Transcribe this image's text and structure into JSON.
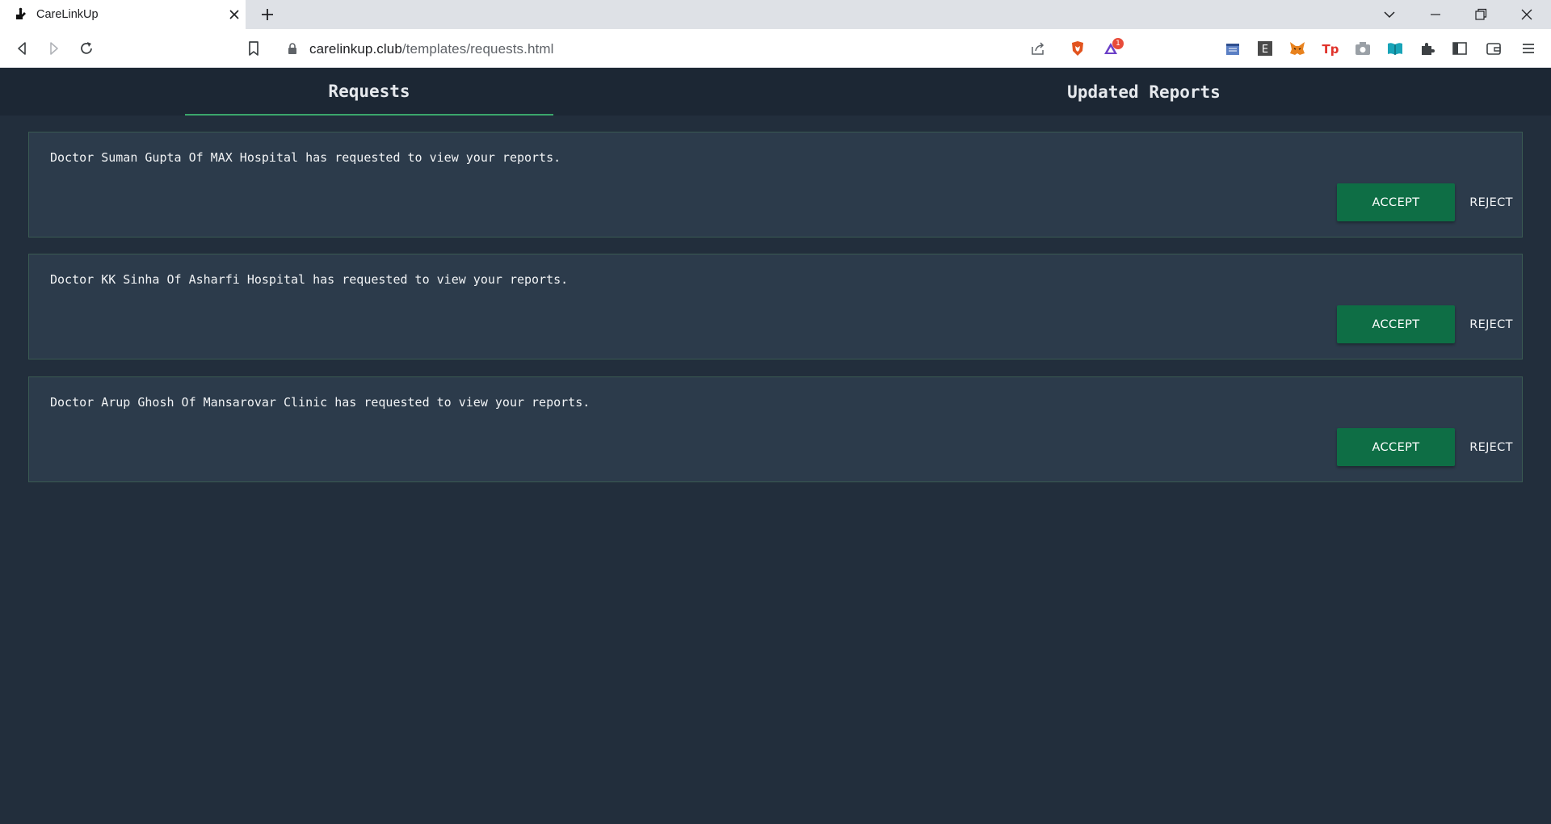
{
  "browser": {
    "tab_title": "CareLinkUp",
    "url_host": "carelinkup.club",
    "url_path": "/templates/requests.html",
    "notification_badge": "1"
  },
  "page": {
    "tabs": [
      {
        "label": "Requests",
        "active": true
      },
      {
        "label": "Updated Reports",
        "active": false
      }
    ],
    "requests": [
      {
        "message": "Doctor Suman Gupta Of MAX Hospital has requested to view your reports.",
        "accept_label": "ACCEPT",
        "reject_label": "REJECT"
      },
      {
        "message": "Doctor KK Sinha Of Asharfi Hospital has requested to view your reports.",
        "accept_label": "ACCEPT",
        "reject_label": "REJECT"
      },
      {
        "message": "Doctor Arup Ghosh Of Mansarovar Clinic has requested to view your reports.",
        "accept_label": "ACCEPT",
        "reject_label": "REJECT"
      }
    ]
  },
  "colors": {
    "page_background": "#222e3c",
    "tab_row_background": "#1c2734",
    "card_background": "#2c3b4b",
    "accept_button": "#0e6e45",
    "active_tab_underline": "#3aa66b"
  },
  "icons": [
    "carelinkup-favicon",
    "close-icon",
    "plus-icon",
    "chevron-down-icon",
    "minimize-icon",
    "restore-icon",
    "close-window-icon",
    "back-icon",
    "forward-icon",
    "reload-icon",
    "bookmark-icon",
    "lock-icon",
    "share-icon",
    "brave-shield-icon",
    "brave-rewards-icon",
    "extensions-icon",
    "sidebar-icon",
    "wallet-icon",
    "menu-icon"
  ]
}
